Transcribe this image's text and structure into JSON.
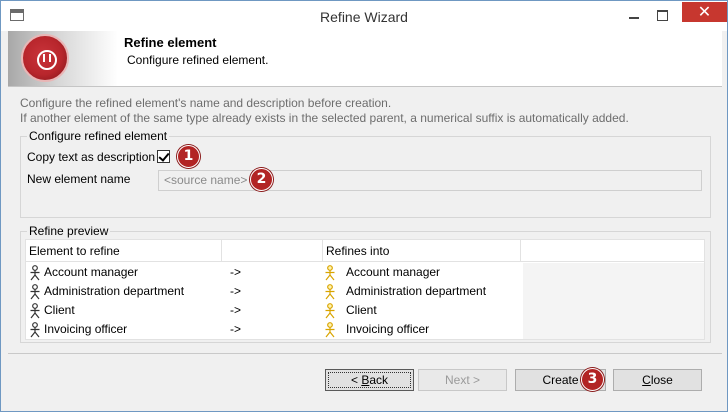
{
  "window": {
    "title": "Refine Wizard",
    "close_glyph": "✕"
  },
  "banner": {
    "title": "Refine element",
    "subtitle": "Configure refined element."
  },
  "help": {
    "line1": "Configure the refined element's name and description before creation.",
    "line2": "If another element of the same type already exists in the selected parent, a numerical suffix is automatically added."
  },
  "configure": {
    "group_label": "Configure refined element",
    "copy_label": "Copy text as description",
    "copy_checked": true,
    "name_label": "New element name",
    "name_placeholder": "<source name>"
  },
  "preview": {
    "group_label": "Refine preview",
    "headers": [
      "Element to refine",
      "",
      "Refines into",
      ""
    ],
    "rows": [
      {
        "source": "Account manager",
        "arrow": "->",
        "target": "Account manager"
      },
      {
        "source": "Administration department",
        "arrow": "->",
        "target": "Administration department"
      },
      {
        "source": "Client",
        "arrow": "->",
        "target": "Client"
      },
      {
        "source": "Invoicing officer",
        "arrow": "->",
        "target": "Invoicing officer"
      }
    ]
  },
  "buttons": {
    "back_prefix": "< ",
    "back_key": "B",
    "back_rest": "ack",
    "next": "Next >",
    "create": "Create",
    "close_key": "C",
    "close_rest": "lose"
  },
  "callouts": [
    "1",
    "2",
    "3"
  ],
  "colors": {
    "accent": "#b22424",
    "actor_source": "#333333",
    "actor_target": "#d9a400"
  }
}
